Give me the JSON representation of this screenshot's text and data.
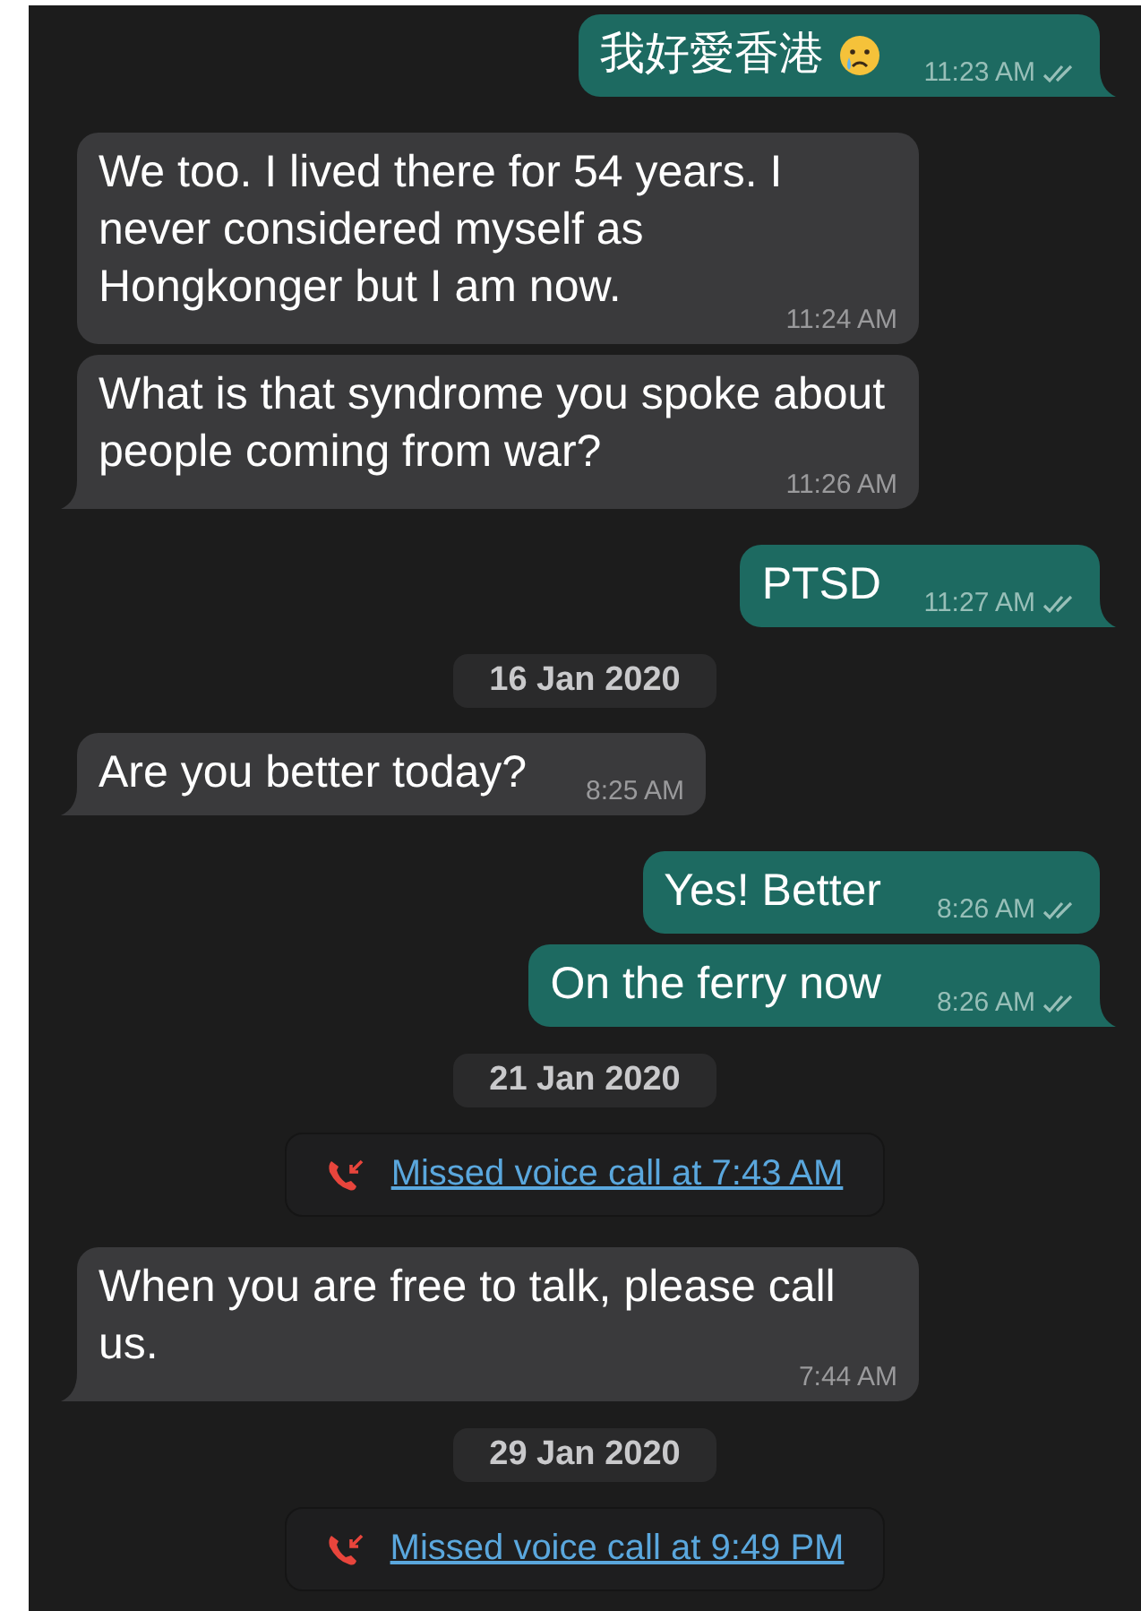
{
  "messages": [
    {
      "kind": "out",
      "text": "我好愛香港",
      "emoji": true,
      "time": "11:23 AM",
      "tail": true,
      "read": true
    },
    {
      "kind": "in",
      "text": "We too. I lived there for 54 years. I never considered myself as Hongkonger but I am now.",
      "time": "11:24 AM",
      "tail": false
    },
    {
      "kind": "in",
      "text": "What is that syndrome you spoke about people coming from war?",
      "time": "11:26 AM",
      "tail": true
    },
    {
      "kind": "out",
      "text": "PTSD",
      "emoji": false,
      "time": "11:27 AM",
      "tail": true,
      "read": true
    },
    {
      "kind": "date",
      "text": "16 Jan 2020"
    },
    {
      "kind": "in",
      "text": "Are you better today?",
      "time": "8:25 AM",
      "tail": true
    },
    {
      "kind": "out",
      "text": "Yes! Better",
      "emoji": false,
      "time": "8:26 AM",
      "tail": false,
      "read": true
    },
    {
      "kind": "out",
      "text": "On the ferry now",
      "emoji": false,
      "time": "8:26 AM",
      "tail": true,
      "read": true
    },
    {
      "kind": "date",
      "text": "21 Jan 2020"
    },
    {
      "kind": "call",
      "text": "Missed voice call at 7:43 AM"
    },
    {
      "kind": "in",
      "text": "When you are free to talk, please call us.",
      "time": "7:44 AM",
      "tail": true
    },
    {
      "kind": "date",
      "text": "29 Jan 2020"
    },
    {
      "kind": "call",
      "text": "Missed voice call at 9:49 PM"
    }
  ]
}
